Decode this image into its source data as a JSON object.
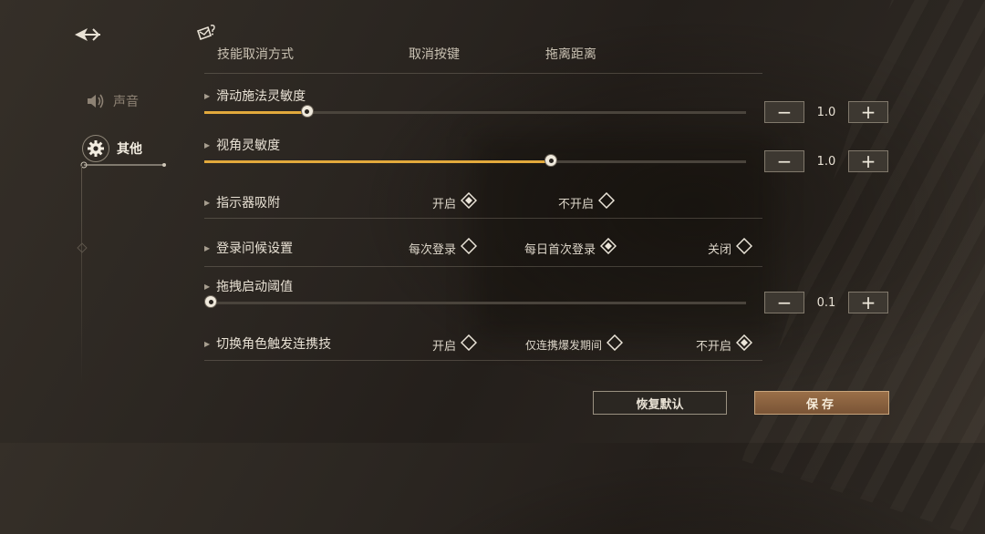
{
  "nav": {
    "items": [
      {
        "label": "声音",
        "icon": "speaker-icon",
        "active": false
      },
      {
        "label": "其他",
        "icon": "gear-icon",
        "active": true
      }
    ]
  },
  "header": {
    "back_icon": "back-arrow-icon",
    "feedback_icon": "feedback-icon"
  },
  "colors": {
    "accent": "#e2a93c",
    "track": "#4a443c",
    "save_button": "#8a6040",
    "text": "#ddd5c6"
  },
  "settings": {
    "cut_row": {
      "label": "技能取消方式",
      "option1": "取消按键",
      "option2": "拖离距离"
    },
    "slide_cast": {
      "label": "滑动施法灵敏度",
      "value": "1.0",
      "fill": 0.19
    },
    "view_angle": {
      "label": "视角灵敏度",
      "value": "1.0",
      "fill": 0.64
    },
    "indicator_snap": {
      "label": "指示器吸附",
      "options": [
        {
          "label": "开启",
          "selected": true
        },
        {
          "label": "不开启",
          "selected": false
        }
      ]
    },
    "login_greeting": {
      "label": "登录问候设置",
      "options": [
        {
          "label": "每次登录",
          "selected": false
        },
        {
          "label": "每日首次登录",
          "selected": true
        },
        {
          "label": "关闭",
          "selected": false
        }
      ]
    },
    "drag_threshold": {
      "label": "拖拽启动阈值",
      "value": "0.1",
      "fill": 0.0
    },
    "switch_combo": {
      "label": "切换角色触发连携技",
      "options": [
        {
          "label": "开启",
          "selected": false
        },
        {
          "label": "仅连携爆发期间",
          "selected": false
        },
        {
          "label": "不开启",
          "selected": true
        }
      ]
    }
  },
  "buttons": {
    "reset": "恢复默认",
    "save": "保存"
  }
}
